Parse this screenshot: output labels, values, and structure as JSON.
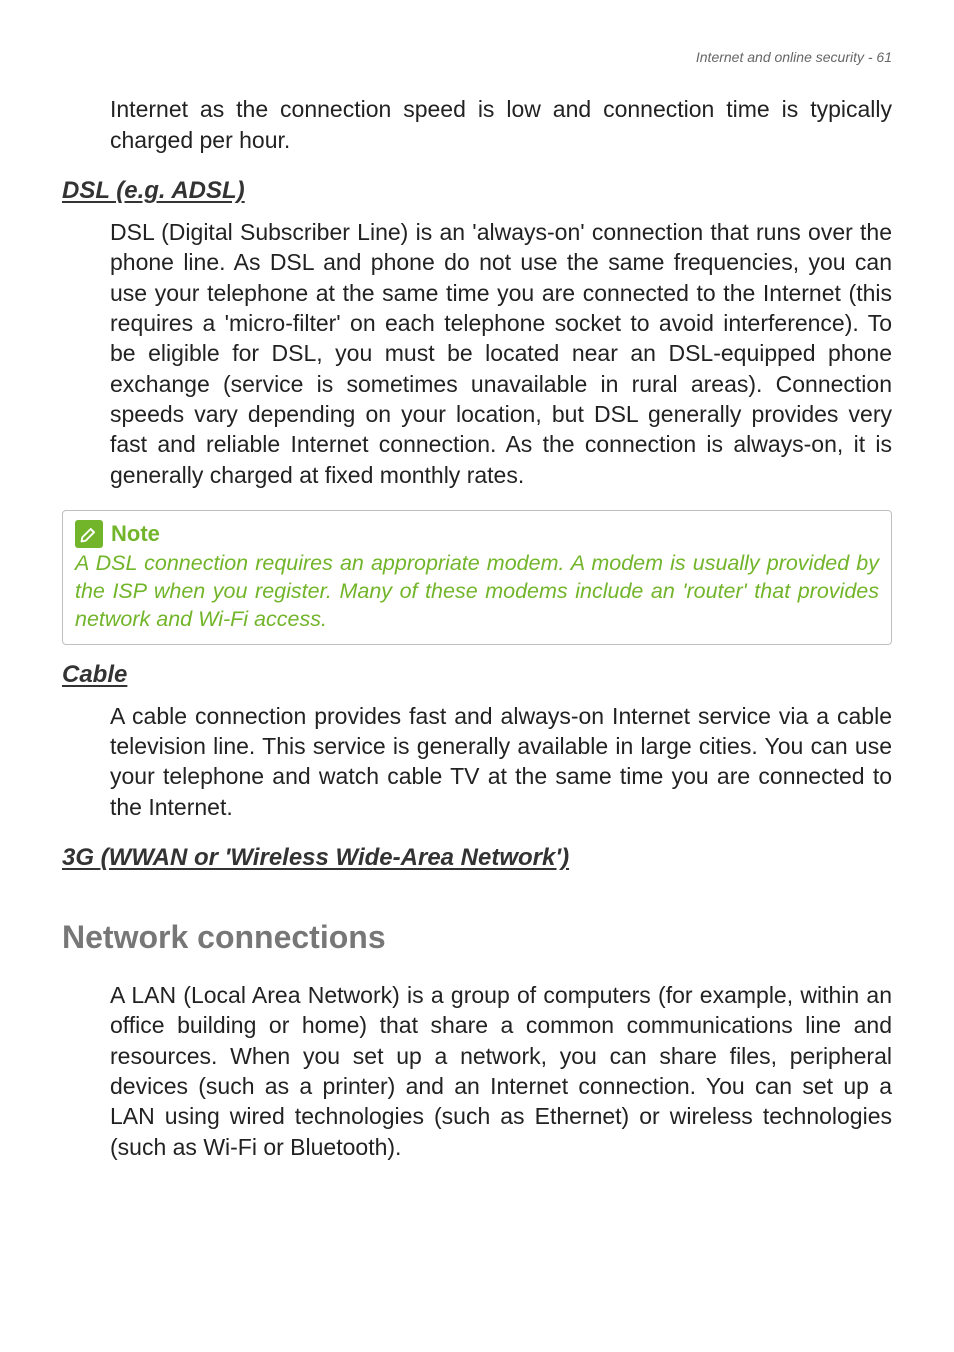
{
  "header": {
    "running_head": "Internet and online security - 61"
  },
  "intro_paragraph": "Internet as the connection speed is low and connection time is typically charged per hour.",
  "dsl": {
    "heading": "DSL (e.g. ADSL)",
    "body": "DSL (Digital Subscriber Line) is an 'always-on' connection that runs over the phone line. As DSL and phone do not use the same frequencies, you can use your telephone at the same time you are connected to the Internet (this requires a 'micro-filter' on each telephone socket to avoid interference). To be eligible for DSL, you must be located near an DSL-equipped phone exchange (service is sometimes unavailable in rural areas). Connection speeds vary depending on your location, but DSL generally provides very fast and reliable Internet connection. As the connection is always-on, it is generally charged at fixed monthly rates."
  },
  "note": {
    "label": "Note",
    "body": "A DSL connection requires an appropriate modem. A modem is usually provided by the ISP when you register. Many of these modems include an 'router' that provides network and Wi-Fi access."
  },
  "cable": {
    "heading": "Cable",
    "body": "A cable connection provides fast and always-on Internet service via a cable television line. This service is generally available in large cities. You can use your telephone and watch cable TV at the same time you are connected to the Internet."
  },
  "threeg": {
    "heading": "3G (WWAN or 'Wireless Wide-Area Network')"
  },
  "network": {
    "heading": "Network connections",
    "body": "A LAN (Local Area Network) is a group of computers (for example, within an office building or home) that share a common communications line and resources. When you set up a network, you can share files, peripheral devices (such as a printer) and an Internet connection. You can set up a LAN using wired technologies (such as Ethernet) or wireless technologies (such as Wi-Fi or Bluetooth)."
  }
}
